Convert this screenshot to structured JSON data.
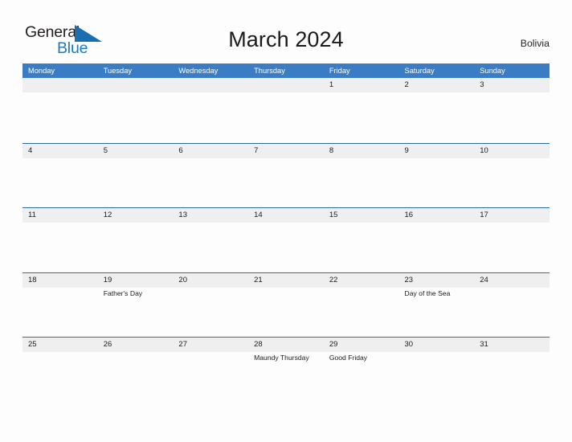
{
  "brand": {
    "name_part1": "General",
    "name_part2": "Blue",
    "flag_icon": "blue-flag-triangle",
    "color_dark": "#231f20",
    "color_blue": "#1b7ac4"
  },
  "header": {
    "title": "March 2024",
    "country": "Bolivia"
  },
  "theme": {
    "header_band": "#3b7dc4",
    "row_border": "#2d6ca8",
    "date_band": "#efefef",
    "page_background": "#fdfdfd",
    "text": "#1a1a1a"
  },
  "weekday_headers": [
    "Monday",
    "Tuesday",
    "Wednesday",
    "Thursday",
    "Friday",
    "Saturday",
    "Sunday"
  ],
  "weeks": [
    {
      "days": [
        {
          "date": "",
          "events": []
        },
        {
          "date": "",
          "events": []
        },
        {
          "date": "",
          "events": []
        },
        {
          "date": "",
          "events": []
        },
        {
          "date": "1",
          "events": []
        },
        {
          "date": "2",
          "events": []
        },
        {
          "date": "3",
          "events": []
        }
      ]
    },
    {
      "days": [
        {
          "date": "4",
          "events": []
        },
        {
          "date": "5",
          "events": []
        },
        {
          "date": "6",
          "events": []
        },
        {
          "date": "7",
          "events": []
        },
        {
          "date": "8",
          "events": []
        },
        {
          "date": "9",
          "events": []
        },
        {
          "date": "10",
          "events": []
        }
      ]
    },
    {
      "days": [
        {
          "date": "11",
          "events": []
        },
        {
          "date": "12",
          "events": []
        },
        {
          "date": "13",
          "events": []
        },
        {
          "date": "14",
          "events": []
        },
        {
          "date": "15",
          "events": []
        },
        {
          "date": "16",
          "events": []
        },
        {
          "date": "17",
          "events": []
        }
      ]
    },
    {
      "days": [
        {
          "date": "18",
          "events": []
        },
        {
          "date": "19",
          "events": [
            "Father's Day"
          ]
        },
        {
          "date": "20",
          "events": []
        },
        {
          "date": "21",
          "events": []
        },
        {
          "date": "22",
          "events": []
        },
        {
          "date": "23",
          "events": [
            "Day of the Sea"
          ]
        },
        {
          "date": "24",
          "events": []
        }
      ]
    },
    {
      "days": [
        {
          "date": "25",
          "events": []
        },
        {
          "date": "26",
          "events": []
        },
        {
          "date": "27",
          "events": []
        },
        {
          "date": "28",
          "events": [
            "Maundy Thursday"
          ]
        },
        {
          "date": "29",
          "events": [
            "Good Friday"
          ]
        },
        {
          "date": "30",
          "events": []
        },
        {
          "date": "31",
          "events": []
        }
      ]
    }
  ]
}
